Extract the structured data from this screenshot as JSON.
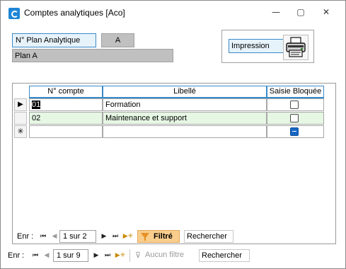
{
  "window": {
    "title": "Comptes analytiques [Aco]",
    "minimize_glyph": "—",
    "maximize_glyph": "▢",
    "close_glyph": "✕"
  },
  "header": {
    "plan_label": "N° Plan Analytique",
    "plan_code": "A",
    "plan_name": "Plan A",
    "print_label": "Impression"
  },
  "grid": {
    "columns": [
      "N° compte",
      "Libellé",
      "Saisie Bloquée"
    ],
    "rows": [
      {
        "indicator": "▶",
        "compte": "01",
        "libelle": "Formation",
        "bloquee": false
      },
      {
        "indicator": "",
        "compte": "02",
        "libelle": "Maintenance et support",
        "bloquee": false
      }
    ],
    "new_row_indicator": "✳"
  },
  "inner_nav": {
    "label": "Enr :",
    "first": "⏮",
    "prev": "◀",
    "next": "▶",
    "last": "⏭",
    "new": "▶✳",
    "record": "1 sur 2",
    "filter_label": "Filtré",
    "search_label": "Rechercher"
  },
  "outer_nav": {
    "label": "Enr :",
    "first": "⏮",
    "prev": "◀",
    "next": "▶",
    "last": "⏭",
    "new": "▶✳",
    "record": "1 sur 9",
    "filter_label": "Aucun filtre",
    "search_label": "Rechercher"
  },
  "colors": {
    "accent": "#3a8ac8",
    "row_green": "#e6f7e4",
    "filter_on": "#f9ce8d",
    "app_icon": "#1e86d6"
  }
}
